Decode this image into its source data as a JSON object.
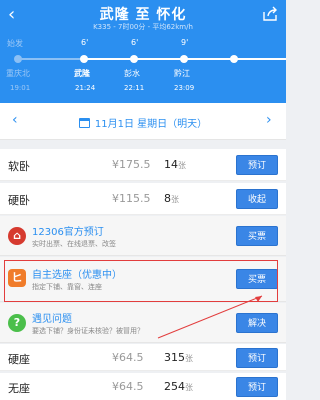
{
  "header": {
    "title": "武隆 至 怀化",
    "subtitle": "K335 - 7时00分 - 平均62km/h",
    "back_icon": "chevron-left-icon",
    "share_icon": "share-icon"
  },
  "route": [
    {
      "name": "重庆北",
      "time": "19:01",
      "duration": "始发",
      "state": "past"
    },
    {
      "name": "武隆",
      "time": "21:24",
      "duration": "6'",
      "state": "current"
    },
    {
      "name": "彭水",
      "time": "22:11",
      "duration": "6'",
      "state": "normal"
    },
    {
      "name": "黔江",
      "time": "23:09",
      "duration": "9'",
      "state": "normal"
    }
  ],
  "datebar": {
    "date": "11月1日",
    "weekday": "星期日（明天）",
    "prev": "‹",
    "next": "›"
  },
  "seats": [
    {
      "name": "软卧",
      "price": "¥175.5",
      "count": "14",
      "unit": "张",
      "action": "预订"
    },
    {
      "name": "硬卧",
      "price": "¥115.5",
      "count": "8",
      "unit": "张",
      "action": "收起"
    },
    {
      "name": "硬座",
      "price": "¥64.5",
      "count": "315",
      "unit": "张",
      "action": "预订"
    },
    {
      "name": "无座",
      "price": "¥64.5",
      "count": "254",
      "unit": "张",
      "action": "预订"
    }
  ],
  "options": [
    {
      "title": "12306官方预订",
      "desc": "实时出票、在线退票、改签",
      "action": "买票",
      "icon": "12306-logo-icon",
      "icon_color": "#d63a2f"
    },
    {
      "title": "自主选座（优惠中）",
      "desc": "指定下铺、靠窗、连座",
      "action": "买票",
      "icon": "seat-select-icon",
      "icon_color": "#f07c2a"
    },
    {
      "title": "遇见问题",
      "desc": "要选下铺？身份证未核验？被冒用？",
      "action": "解决",
      "icon": "question-icon",
      "icon_color": "#4bbf4b"
    }
  ],
  "colors": {
    "header": "#2b8ff0",
    "button": "#3a86e6",
    "highlight_border": "#e23d3d"
  }
}
